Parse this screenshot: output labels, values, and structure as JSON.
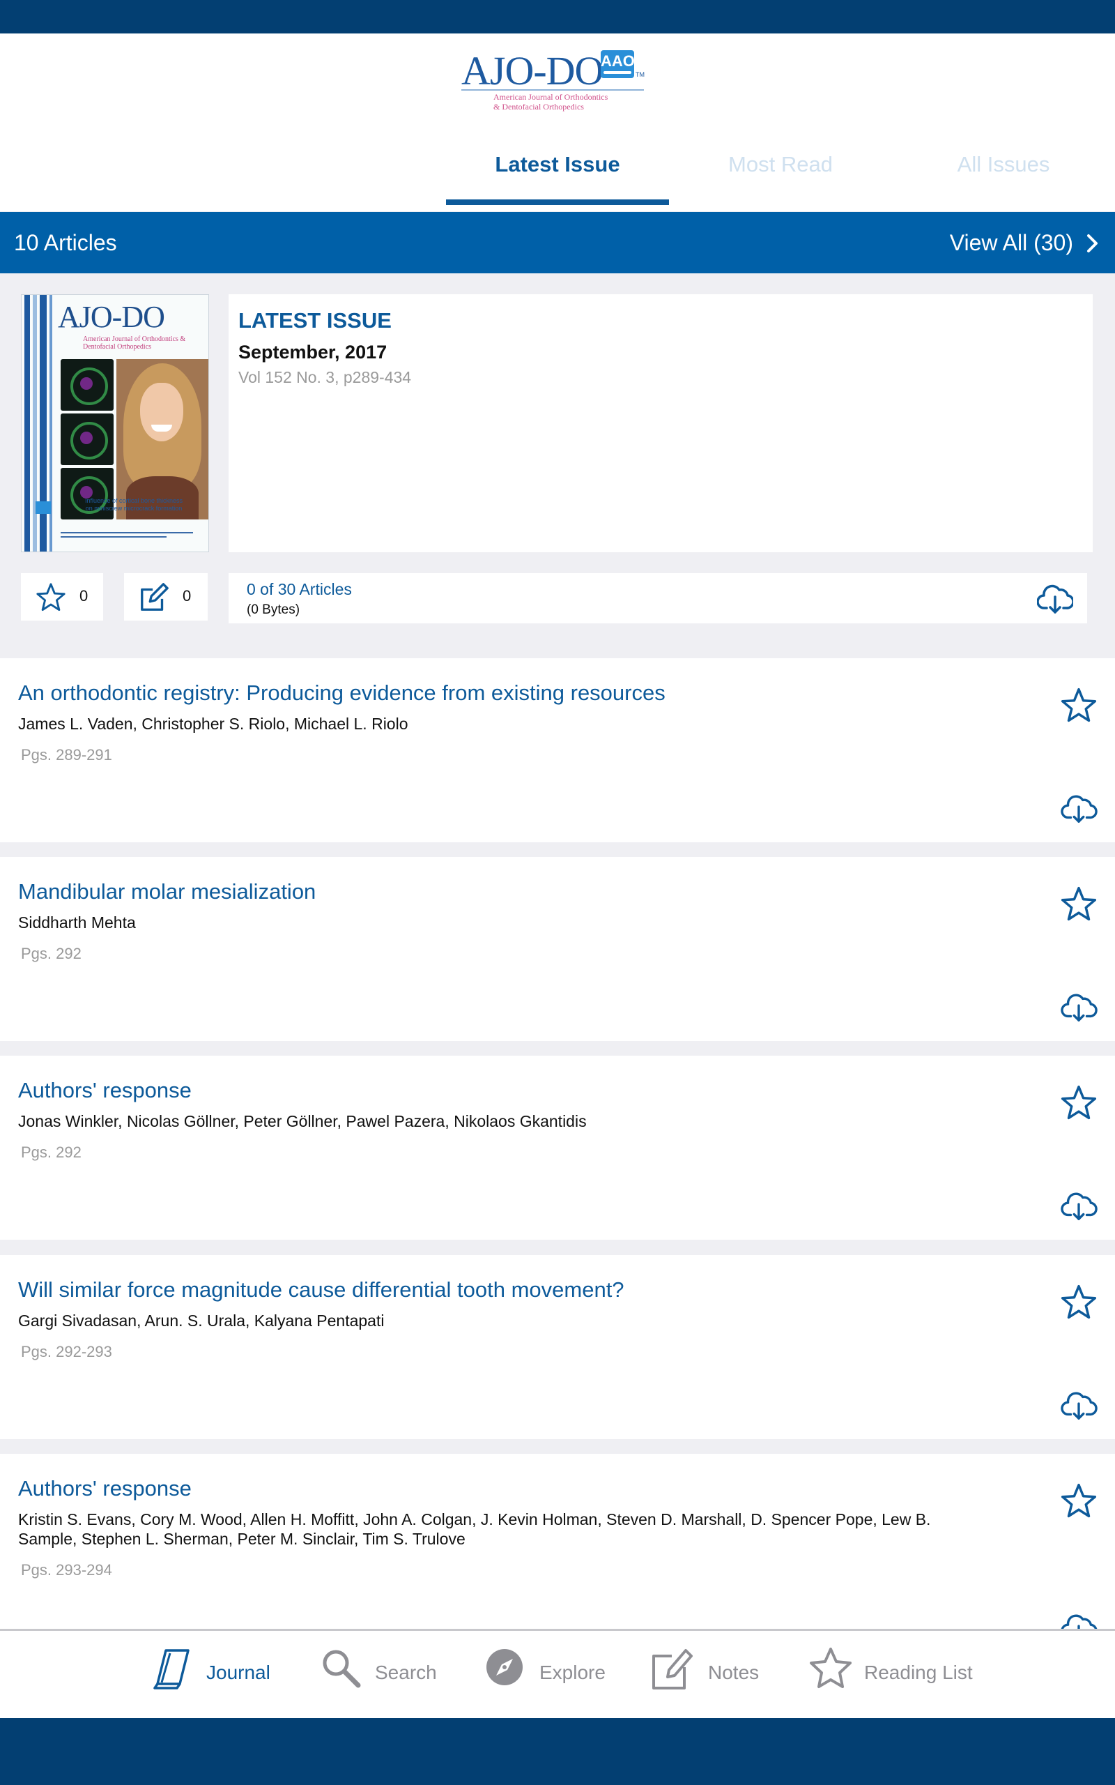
{
  "app": {
    "logo_text": "AJO-DO",
    "logo_badge": "AAO",
    "logo_subtitle_line1": "American Journal of Orthodontics",
    "logo_subtitle_line2": "& Dentofacial Orthopedics"
  },
  "tabs": [
    {
      "label": "Latest Issue",
      "active": true
    },
    {
      "label": "Most Read",
      "active": false
    },
    {
      "label": "All Issues",
      "active": false
    }
  ],
  "articles_bar": {
    "count_label": "10 Articles",
    "view_all_label": "View All (30)"
  },
  "issue": {
    "cover_title": "AJO-DO",
    "cover_subtitle": "American Journal of Orthodontics & Dentofacial Orthopedics",
    "cover_caption": "Influence of cortical bone thickness on miniscrew microcrack formation",
    "label": "LATEST ISSUE",
    "date": "September, 2017",
    "volume": "Vol 152 No. 3, p289-434",
    "favorites_count": "0",
    "notes_count": "0",
    "download_status": "0 of 30 Articles",
    "download_size": "(0 Bytes)"
  },
  "articles": [
    {
      "title": "An orthodontic registry: Producing evidence from existing resources",
      "authors": "James L. Vaden, Christopher S. Riolo, Michael L. Riolo",
      "pages": "Pgs. 289-291"
    },
    {
      "title": "Mandibular molar mesialization",
      "authors": "Siddharth Mehta",
      "pages": "Pgs. 292"
    },
    {
      "title": "Authors' response",
      "authors": "Jonas Winkler, Nicolas Göllner, Peter Göllner, Pawel Pazera, Nikolaos Gkantidis",
      "pages": "Pgs. 292"
    },
    {
      "title": "Will similar force magnitude cause differential tooth movement?",
      "authors": "Gargi Sivadasan, Arun. S. Urala, Kalyana Pentapati",
      "pages": "Pgs. 292-293"
    },
    {
      "title": "Authors' response",
      "authors": "Kristin S. Evans, Cory M. Wood, Allen H. Moffitt, John A. Colgan, J. Kevin Holman, Steven D. Marshall, D. Spencer Pope, Lew B. Sample, Stephen L. Sherman, Peter M. Sinclair, Tim S. Trulove",
      "pages": "Pgs. 293-294"
    }
  ],
  "bottom_nav": [
    {
      "label": "Journal",
      "icon": "journal-icon",
      "active": true
    },
    {
      "label": "Search",
      "icon": "search-icon",
      "active": false
    },
    {
      "label": "Explore",
      "icon": "compass-icon",
      "active": false
    },
    {
      "label": "Notes",
      "icon": "note-icon",
      "active": false
    },
    {
      "label": "Reading List",
      "icon": "star-icon",
      "active": false
    }
  ],
  "colors": {
    "brand_dark": "#033f72",
    "brand_blue": "#0060a8",
    "link_blue": "#0d5a9a",
    "inactive_tab": "#cfe0ef",
    "muted_text": "#9a9a9a",
    "background": "#efeff3"
  }
}
